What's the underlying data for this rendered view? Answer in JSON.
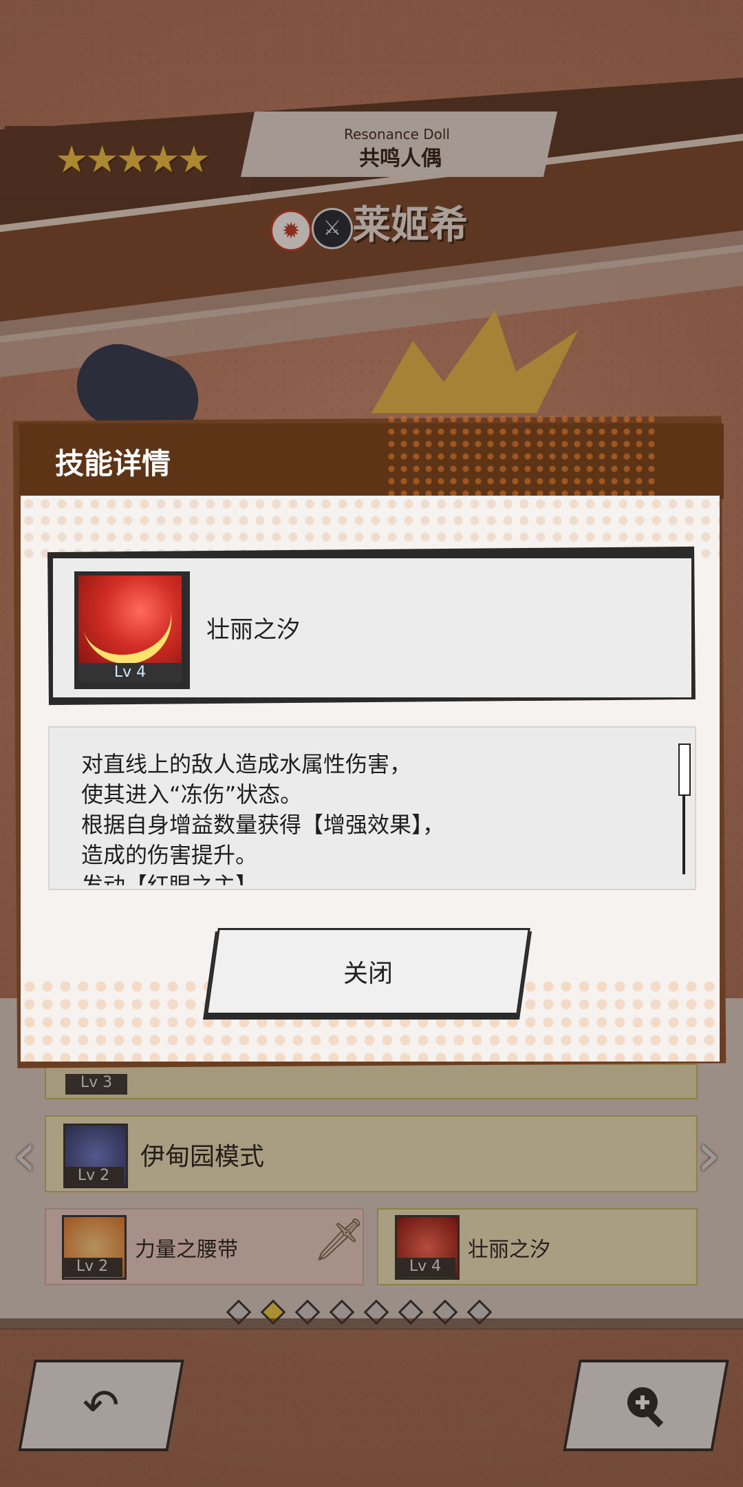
{
  "character": {
    "rarity_stars": "★★★★★",
    "series_en": "Resonance Doll",
    "series_cn": "共鸣人偶",
    "element_icon": "fire-icon",
    "weapon_icon": "sword-icon",
    "name": "莱姬希"
  },
  "dialog": {
    "title": "技能详情",
    "skill": {
      "name": "壮丽之汐",
      "level": "Lv 4"
    },
    "description": "对直线上的敌人造成水属性伤害，\n使其进入“冻伤”状态。\n根据自身增益数量获得【增强效果】，\n造成的伤害提升。\n发动【红眼之主】",
    "close_label": "关闭"
  },
  "skill_list": {
    "rows": [
      {
        "name": "",
        "level": "Lv 3"
      },
      {
        "name": "伊甸园模式",
        "level": "Lv 2"
      },
      {
        "name": "力量之腰带",
        "level": "Lv 2"
      },
      {
        "name": "壮丽之汐",
        "level": "Lv 4"
      }
    ],
    "page_count": 8,
    "active_page": 2
  },
  "nav": {
    "back_icon": "back-arrow-icon",
    "zoom_icon": "zoom-in-icon"
  },
  "colors": {
    "accent": "#f0d24a",
    "dialog_header": "#5e3417",
    "star": "#f4c64a"
  }
}
